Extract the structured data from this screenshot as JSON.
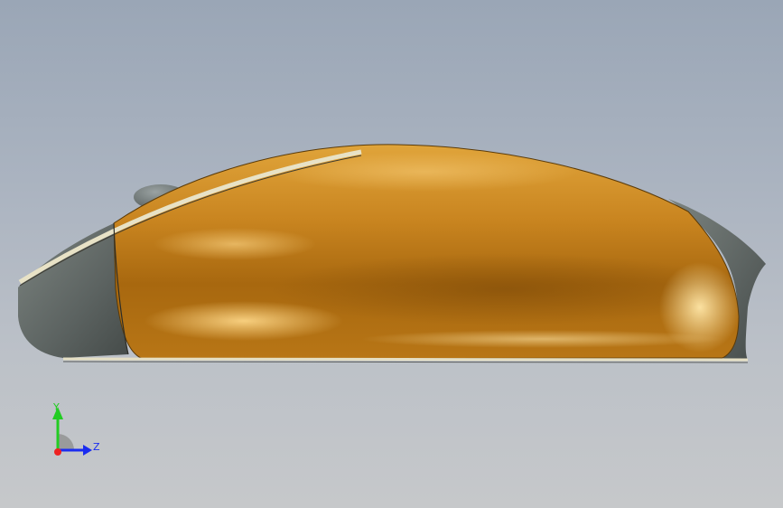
{
  "viewport": {
    "model_name": "",
    "colors": {
      "background_top": "#9aa6b6",
      "background_bottom": "#c6c8ca",
      "shell": "#c8821e",
      "shell_highlight": "#f3c366",
      "shell_shadow": "#8a5410",
      "trim": "#6f7673",
      "trim_dark": "#4e5452",
      "button_strip": "#e6e0c4"
    }
  },
  "triad": {
    "y_label": "Y",
    "z_label": "Z",
    "y_color": "#22cc22",
    "z_color": "#1a2cf0",
    "x_color": "#ee2222"
  }
}
